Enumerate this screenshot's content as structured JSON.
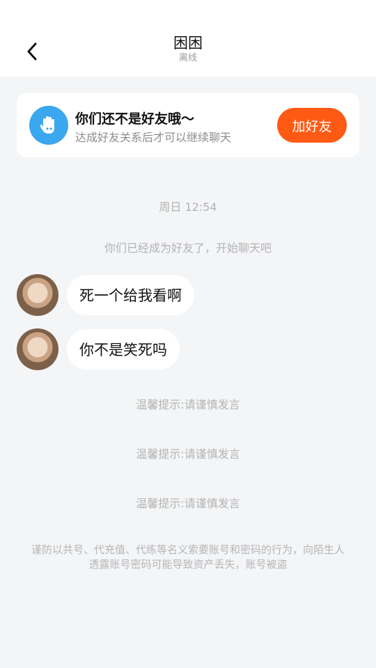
{
  "header": {
    "title": "困困",
    "status": "离线"
  },
  "friend_card": {
    "title": "你们还不是好友哦～",
    "description": "达成好友关系后才可以继续聊天",
    "add_button": "加好友"
  },
  "chat": {
    "timestamp": "周日 12:54",
    "system_message": "你们已经成为好友了，开始聊天吧",
    "messages": [
      {
        "text": "死一个给我看啊"
      },
      {
        "text": "你不是笑死吗"
      }
    ],
    "tips": [
      "温馨提示:请谨慎发言",
      "温馨提示:请谨慎发言",
      "温馨提示:请谨慎发言"
    ],
    "warning": "谨防以共号、代充值、代练等名义索要账号和密码的行为，向陌生人透露账号密码可能导致资产丢失，账号被盗"
  },
  "colors": {
    "accent": "#ff5a14",
    "icon_blue": "#3ba7ee",
    "background": "#f4f5f7"
  },
  "icons": [
    "back-arrow-icon",
    "waving-hand-icon"
  ]
}
